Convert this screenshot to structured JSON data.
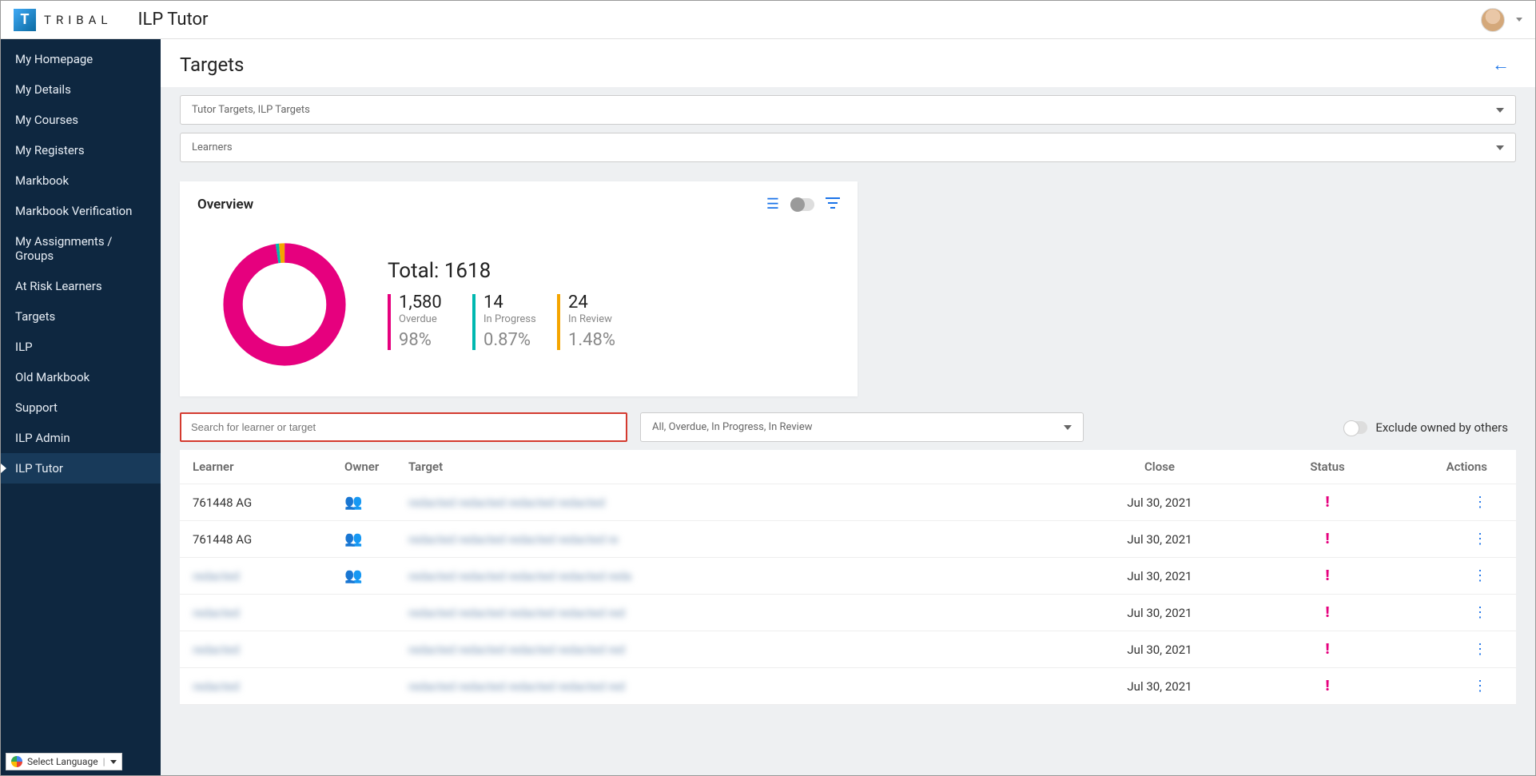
{
  "brand": {
    "mark": "T",
    "name": "TRIBAL"
  },
  "app_title": "ILP Tutor",
  "sidebar": {
    "items": [
      {
        "label": "My Homepage"
      },
      {
        "label": "My Details"
      },
      {
        "label": "My Courses"
      },
      {
        "label": "My Registers"
      },
      {
        "label": "Markbook"
      },
      {
        "label": "Markbook Verification"
      },
      {
        "label": "My Assignments / Groups"
      },
      {
        "label": "At Risk Learners"
      },
      {
        "label": "Targets"
      },
      {
        "label": "ILP"
      },
      {
        "label": "Old Markbook"
      },
      {
        "label": "Support"
      },
      {
        "label": "ILP Admin"
      },
      {
        "label": "ILP Tutor",
        "active": true
      }
    ]
  },
  "lang": {
    "text": "Select Language"
  },
  "page_title": "Targets",
  "filters": {
    "target_types": "Tutor Targets, ILP Targets",
    "learners": "Learners"
  },
  "overview": {
    "title": "Overview",
    "total_label": "Total:",
    "total_value": "1618",
    "stats": [
      {
        "num": "1,580",
        "label": "Overdue",
        "pct": "98%",
        "color": "#e6007e"
      },
      {
        "num": "14",
        "label": "In Progress",
        "pct": "0.87%",
        "color": "#00b8b0"
      },
      {
        "num": "24",
        "label": "In Review",
        "pct": "1.48%",
        "color": "#f5a500"
      }
    ]
  },
  "chart_data": {
    "type": "pie",
    "title": "Overview",
    "series": [
      {
        "name": "Overdue",
        "value": 1580,
        "pct": 97.65,
        "color": "#e6007e"
      },
      {
        "name": "In Progress",
        "value": 14,
        "pct": 0.87,
        "color": "#00b8b0"
      },
      {
        "name": "In Review",
        "value": 24,
        "pct": 1.48,
        "color": "#f5a500"
      }
    ],
    "total": 1618,
    "donut": true
  },
  "search": {
    "placeholder": "Search for learner or target"
  },
  "status_filter": "All, Overdue, In Progress, In Review",
  "exclude_label": "Exclude owned by others",
  "table": {
    "headers": {
      "learner": "Learner",
      "owner": "Owner",
      "target": "Target",
      "close": "Close",
      "status": "Status",
      "actions": "Actions"
    },
    "rows": [
      {
        "learner": "761448 AG",
        "owner": true,
        "target": "redacted redacted redacted redacted",
        "close": "Jul 30, 2021",
        "status": "!",
        "blur_learner": false
      },
      {
        "learner": "761448 AG",
        "owner": true,
        "target": "redacted redacted redacted redacted re",
        "close": "Jul 30, 2021",
        "status": "!",
        "blur_learner": false
      },
      {
        "learner": "redacted",
        "owner": true,
        "target": "redacted redacted redacted redacted reda",
        "close": "Jul 30, 2021",
        "status": "!",
        "blur_learner": true
      },
      {
        "learner": "redacted",
        "owner": false,
        "target": "redacted redacted redacted redacted red",
        "close": "Jul 30, 2021",
        "status": "!",
        "blur_learner": true
      },
      {
        "learner": "redacted",
        "owner": false,
        "target": "redacted redacted redacted redacted red",
        "close": "Jul 30, 2021",
        "status": "!",
        "blur_learner": true
      },
      {
        "learner": "redacted",
        "owner": false,
        "target": "redacted redacted redacted redacted red",
        "close": "Jul 30, 2021",
        "status": "!",
        "blur_learner": true
      }
    ]
  }
}
